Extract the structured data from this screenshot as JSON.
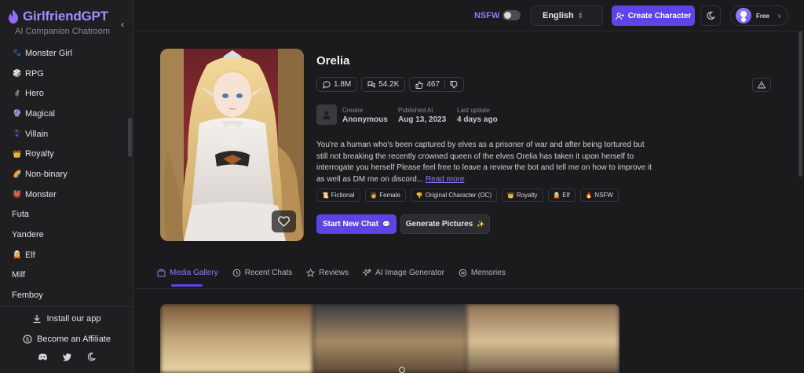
{
  "brand": {
    "title": "GirlfriendGPT",
    "subtitle": "AI Companion Chatroom"
  },
  "sidebar": {
    "items": [
      {
        "emoji": "🐾",
        "label": "Monster Girl"
      },
      {
        "emoji": "🎲",
        "label": "RPG"
      },
      {
        "emoji": "🦸",
        "label": "Hero"
      },
      {
        "emoji": "🔮",
        "label": "Magical"
      },
      {
        "emoji": "🦹",
        "label": "Villain"
      },
      {
        "emoji": "👑",
        "label": "Royalty"
      },
      {
        "emoji": "🌈",
        "label": "Non-binary"
      },
      {
        "emoji": "👹",
        "label": "Monster"
      },
      {
        "emoji": "",
        "label": "Futa"
      },
      {
        "emoji": "",
        "label": "Yandere"
      },
      {
        "emoji": "🧝",
        "label": "Elf"
      },
      {
        "emoji": "",
        "label": "Milf"
      },
      {
        "emoji": "",
        "label": "Femboy"
      }
    ],
    "install": "Install our app",
    "affiliate": "Become an Affiliate"
  },
  "topbar": {
    "nsfw": "NSFW",
    "language": "English",
    "create": "Create Character",
    "plan": "Free"
  },
  "character": {
    "name": "Orelia",
    "stats": {
      "messages": "1.8M",
      "chats": "54.2K",
      "likes": "467"
    },
    "creator_label": "Creator",
    "creator": "Anonymous",
    "published_label": "Published At",
    "published": "Aug 13, 2023",
    "updated_label": "Last update",
    "updated": "4 days ago",
    "description": "You're a human who's been captured by elves as a prisoner of war and after being tortured but still not breaking the recently crowned queen of the elves Orelia has taken it upon herself to interrogate you herself Please feel free to leave a review the bot and tell me on how to improve it as well as DM me on discord... ",
    "read_more": "Read more",
    "tags": [
      {
        "emoji": "📜",
        "label": "Fictional"
      },
      {
        "emoji": "👩",
        "label": "Female"
      },
      {
        "emoji": "👎",
        "label": "Original Character (OC)"
      },
      {
        "emoji": "👑",
        "label": "Royalty"
      },
      {
        "emoji": "🧝",
        "label": "Elf"
      },
      {
        "emoji": "🔥",
        "label": "NSFW"
      }
    ],
    "start_chat": "Start New Chat",
    "start_chat_emoji": "💬",
    "generate": "Generate Pictures",
    "generate_emoji": "✨"
  },
  "tabs": [
    {
      "label": "Media Gallery",
      "icon": "gallery-icon",
      "active": true
    },
    {
      "label": "Recent Chats",
      "icon": "history-icon"
    },
    {
      "label": "Reviews",
      "icon": "star-icon"
    },
    {
      "label": "AI Image Generator",
      "icon": "sparkle-icon"
    },
    {
      "label": "Memories",
      "icon": "brain-icon"
    }
  ],
  "colors": {
    "accent": "#5b45e6",
    "brand": "#a68bff",
    "background": "#1b1b1d"
  }
}
